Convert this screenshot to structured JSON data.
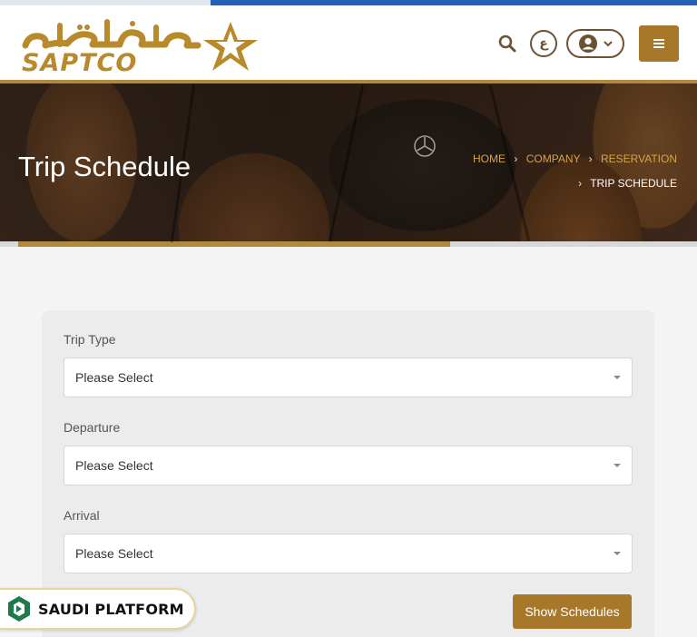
{
  "header": {
    "logo_arabic": "سابتكو",
    "logo_latin": "SAPTCO",
    "icons": {
      "search": "search-icon",
      "language": "ع",
      "user": "user-icon",
      "menu": "menu-icon"
    }
  },
  "hero": {
    "title": "Trip Schedule",
    "breadcrumb": [
      "HOME",
      "COMPANY",
      "RESERVATION",
      "TRIP SCHEDULE"
    ]
  },
  "form": {
    "fields": [
      {
        "label": "Trip Type",
        "value": "Please Select"
      },
      {
        "label": "Departure",
        "value": "Please Select"
      },
      {
        "label": "Arrival",
        "value": "Please Select"
      }
    ],
    "submit_label": "Show Schedules"
  },
  "watermark": {
    "text": "SAUDI PLATFORM"
  },
  "colors": {
    "brand_gold": "#a8782a",
    "breadcrumb_gold": "#d6a24a",
    "top_strip_blue": "#2462b8"
  }
}
